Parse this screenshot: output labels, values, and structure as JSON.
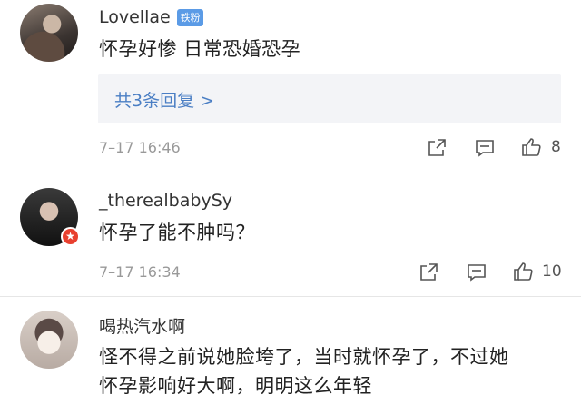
{
  "comments": [
    {
      "username": "Lovellae",
      "badge": "铁粉",
      "text": "怀孕好惨 日常恐婚恐孕",
      "replies_label": "共3条回复 >",
      "time": "7–17 16:46",
      "likes": "8"
    },
    {
      "username": "_therealbabySy",
      "text": "怀孕了能不肿吗？",
      "time": "7–17 16:34",
      "likes": "10"
    },
    {
      "username": "喝热汽水啊",
      "text_line1": "怪不得之前说她脸垮了，当时就怀孕了，不过她",
      "text_line2": "怀孕影响好大啊，明明这么年轻"
    }
  ],
  "colors": {
    "link": "#4a7ec4",
    "fan_badge": "#5b9be6",
    "verified_badge": "#e8402f"
  },
  "icons": [
    "share-icon",
    "comment-icon",
    "like-icon",
    "verified-badge-icon"
  ]
}
